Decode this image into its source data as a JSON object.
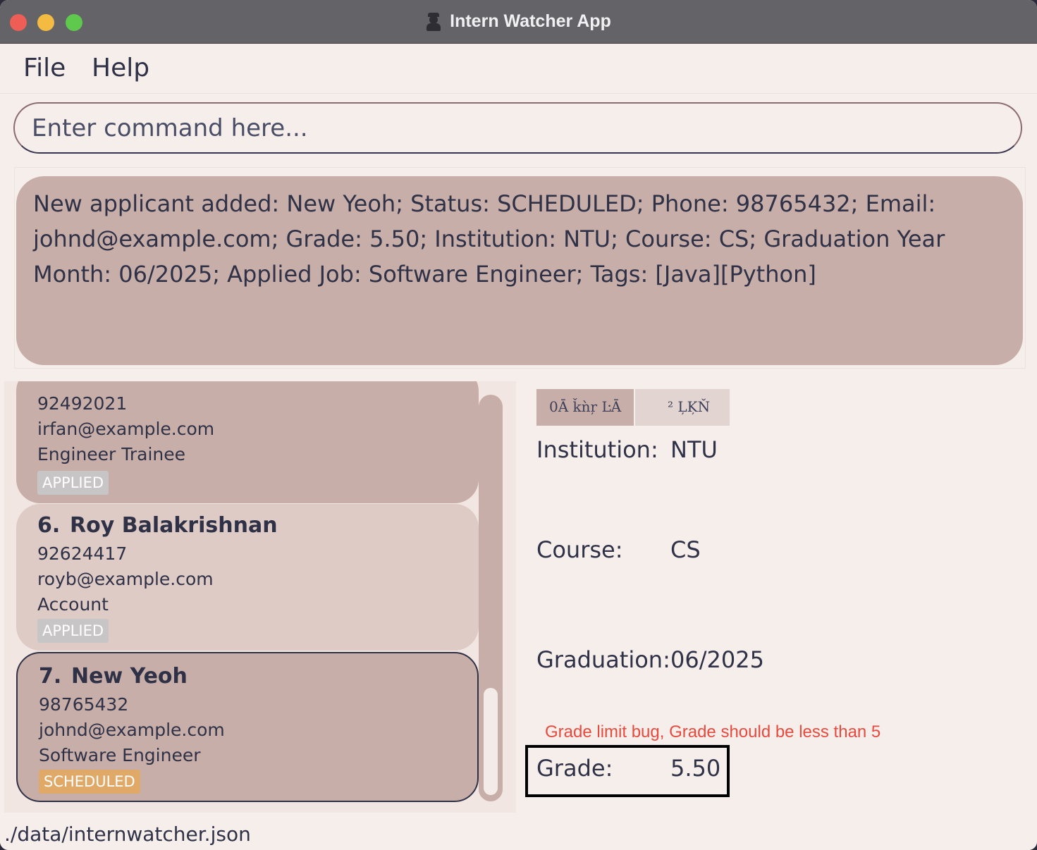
{
  "window": {
    "title": "Intern Watcher App"
  },
  "menu": {
    "file": "File",
    "help": "Help"
  },
  "command": {
    "placeholder": "Enter command here..."
  },
  "result": {
    "message": "New applicant added: New Yeoh; Status: SCHEDULED; Phone: 98765432; Email: johnd@example.com; Grade: 5.50; Institution: NTU; Course: CS; Graduation Year Month: 06/2025; Applied Job: Software Engineer; Tags: [Java][Python]"
  },
  "applicants": [
    {
      "phone": "92492021",
      "email": "irfan@example.com",
      "job": "Engineer Trainee",
      "status": "APPLIED"
    },
    {
      "index": "6.",
      "name": "Roy Balakrishnan",
      "phone": "92624417",
      "email": "royb@example.com",
      "job": "Account",
      "status": "APPLIED"
    },
    {
      "index": "7.",
      "name": "New Yeoh",
      "phone": "98765432",
      "email": "johnd@example.com",
      "job": "Software Engineer",
      "status": "SCHEDULED"
    }
  ],
  "detail": {
    "tabs": [
      "0Ā ǩǹŗ ĿĀ",
      "² ĻĶŇ"
    ],
    "institution_label": "Institution:",
    "institution_value": "NTU",
    "course_label": "Course:",
    "course_value": "CS",
    "graduation_label": "Graduation:",
    "graduation_value": "06/2025",
    "grade_label": "Grade:",
    "grade_value": "5.50"
  },
  "annotation": {
    "text": "Grade limit bug, Grade should be less than 5",
    "color": "#e84a3e"
  },
  "status_bar": {
    "path": "./data/internwatcher.json"
  },
  "colors": {
    "card": "#c8aea8",
    "card_alt": "#dfcbc6",
    "badge_applied": "#c8c5c6",
    "badge_scheduled": "#e0a968",
    "text": "#2f3147"
  }
}
